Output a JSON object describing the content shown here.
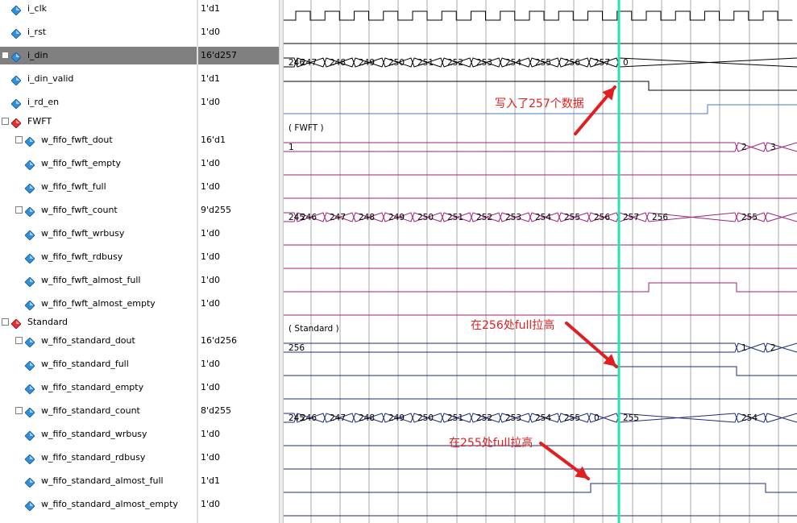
{
  "signals": [
    {
      "name": "i_clk",
      "value": "1'd1",
      "indent": 0,
      "icon": "blue-diamond-icon",
      "expander": ""
    },
    {
      "name": "i_rst",
      "value": "1'd0",
      "indent": 0,
      "icon": "blue-diamond-icon",
      "expander": ""
    },
    {
      "name": "i_din",
      "value": "16'd257",
      "indent": 0,
      "icon": "blue-diamond-icon",
      "expander": "+",
      "selected": true
    },
    {
      "name": "i_din_valid",
      "value": "1'd1",
      "indent": 0,
      "icon": "blue-diamond-icon",
      "expander": ""
    },
    {
      "name": "i_rd_en",
      "value": "1'd0",
      "indent": 0,
      "icon": "blue-diamond-icon",
      "expander": ""
    },
    {
      "name": "FWFT",
      "value": "",
      "indent": 0,
      "icon": "red-diamond-icon",
      "expander": "-",
      "group": true
    },
    {
      "name": "w_fifo_fwft_dout",
      "value": "16'd1",
      "indent": 1,
      "icon": "blue-diamond-icon",
      "expander": "+"
    },
    {
      "name": "w_fifo_fwft_empty",
      "value": "1'd0",
      "indent": 1,
      "icon": "blue-diamond-icon",
      "expander": ""
    },
    {
      "name": "w_fifo_fwft_full",
      "value": "1'd0",
      "indent": 1,
      "icon": "blue-diamond-icon",
      "expander": ""
    },
    {
      "name": "w_fifo_fwft_count",
      "value": "9'd255",
      "indent": 1,
      "icon": "blue-diamond-icon",
      "expander": "+"
    },
    {
      "name": "w_fifo_fwft_wrbusy",
      "value": "1'd0",
      "indent": 1,
      "icon": "blue-diamond-icon",
      "expander": ""
    },
    {
      "name": "w_fifo_fwft_rdbusy",
      "value": "1'd0",
      "indent": 1,
      "icon": "blue-diamond-icon",
      "expander": ""
    },
    {
      "name": "w_fifo_fwft_almost_full",
      "value": "1'd0",
      "indent": 1,
      "icon": "blue-diamond-icon",
      "expander": ""
    },
    {
      "name": "w_fifo_fwft_almost_empty",
      "value": "1'd0",
      "indent": 1,
      "icon": "blue-diamond-icon",
      "expander": ""
    },
    {
      "name": "Standard",
      "value": "",
      "indent": 0,
      "icon": "red-diamond-icon",
      "expander": "-",
      "group": true
    },
    {
      "name": "w_fifo_standard_dout",
      "value": "16'd256",
      "indent": 1,
      "icon": "blue-diamond-icon",
      "expander": "+"
    },
    {
      "name": "w_fifo_standard_full",
      "value": "1'd0",
      "indent": 1,
      "icon": "blue-diamond-icon",
      "expander": ""
    },
    {
      "name": "w_fifo_standard_empty",
      "value": "1'd0",
      "indent": 1,
      "icon": "blue-diamond-icon",
      "expander": ""
    },
    {
      "name": "w_fifo_standard_count",
      "value": "8'd255",
      "indent": 1,
      "icon": "blue-diamond-icon",
      "expander": "+"
    },
    {
      "name": "w_fifo_standard_wrbusy",
      "value": "1'd0",
      "indent": 1,
      "icon": "blue-diamond-icon",
      "expander": ""
    },
    {
      "name": "w_fifo_standard_rdbusy",
      "value": "1'd0",
      "indent": 1,
      "icon": "blue-diamond-icon",
      "expander": ""
    },
    {
      "name": "w_fifo_standard_almost_full",
      "value": "1'd1",
      "indent": 1,
      "icon": "blue-diamond-icon",
      "expander": ""
    },
    {
      "name": "w_fifo_standard_almost_empty",
      "value": "1'd0",
      "indent": 1,
      "icon": "blue-diamond-icon",
      "expander": ""
    }
  ],
  "waves": {
    "group_labels": {
      "fwft": "( FWFT )",
      "standard": "( Standard )"
    },
    "i_din_values": [
      "246",
      "247",
      "248",
      "249",
      "250",
      "251",
      "252",
      "253",
      "254",
      "255",
      "256",
      "257",
      "0"
    ],
    "fwft_dout_values": [
      "1",
      "2",
      "3"
    ],
    "fwft_count_values": [
      "245",
      "246",
      "247",
      "248",
      "249",
      "250",
      "251",
      "252",
      "253",
      "254",
      "255",
      "256",
      "257",
      "256",
      "255"
    ],
    "standard_dout_values": [
      "256",
      "1",
      "2"
    ],
    "standard_count_values": [
      "245",
      "246",
      "247",
      "248",
      "249",
      "250",
      "251",
      "252",
      "253",
      "254",
      "255",
      "0",
      "255",
      "254"
    ],
    "colors": {
      "black": "#000000",
      "blue": "#4a78c8",
      "magenta": "#a0207a",
      "navy": "#1c2a78",
      "cursor": "#28e0b0",
      "annotation": "#e02020",
      "grid": "#a8a8a8"
    }
  },
  "annotations": [
    "写入了257个数据",
    "在256处full拉高",
    "在255处full拉高"
  ]
}
